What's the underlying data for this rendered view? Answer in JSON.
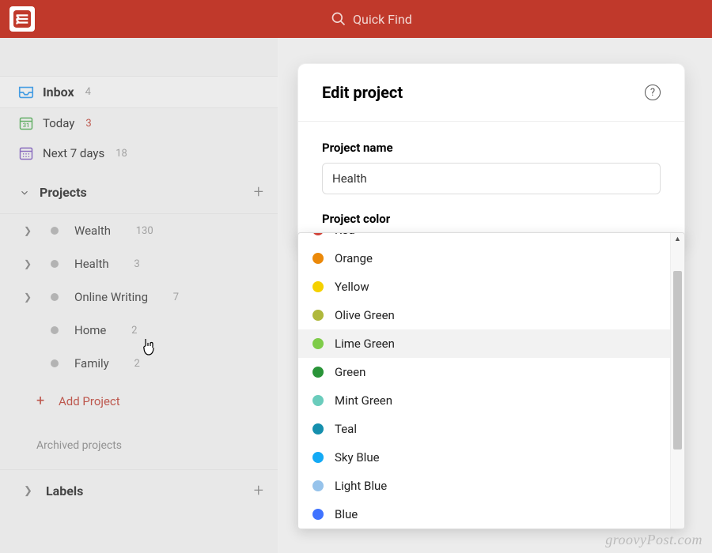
{
  "header": {
    "search_placeholder": "Quick Find"
  },
  "sidebar": {
    "inbox": {
      "label": "Inbox",
      "count": "4"
    },
    "today": {
      "label": "Today",
      "count": "3"
    },
    "next7": {
      "label": "Next 7 days",
      "count": "18"
    },
    "projects_title": "Projects",
    "projects": [
      {
        "name": "Wealth",
        "count": "130",
        "expandable": true
      },
      {
        "name": "Health",
        "count": "3",
        "expandable": true
      },
      {
        "name": "Online Writing",
        "count": "7",
        "expandable": true
      },
      {
        "name": "Home",
        "count": "2",
        "expandable": false
      },
      {
        "name": "Family",
        "count": "2",
        "expandable": false
      }
    ],
    "add_project": "Add Project",
    "archived": "Archived projects",
    "labels_title": "Labels"
  },
  "modal": {
    "title": "Edit project",
    "name_label": "Project name",
    "name_value": "Health",
    "color_label": "Project color"
  },
  "colors": [
    {
      "name": "Red",
      "hex": "#d1453b",
      "partial_top": true
    },
    {
      "name": "Orange",
      "hex": "#eb8909"
    },
    {
      "name": "Yellow",
      "hex": "#f5d100"
    },
    {
      "name": "Olive Green",
      "hex": "#afb83b"
    },
    {
      "name": "Lime Green",
      "hex": "#7ecc49",
      "hovered": true
    },
    {
      "name": "Green",
      "hex": "#299438"
    },
    {
      "name": "Mint Green",
      "hex": "#6accbc"
    },
    {
      "name": "Teal",
      "hex": "#158fad"
    },
    {
      "name": "Sky Blue",
      "hex": "#14aaf5"
    },
    {
      "name": "Light Blue",
      "hex": "#96c3eb"
    },
    {
      "name": "Blue",
      "hex": "#4073ff",
      "partial_bottom": true
    }
  ],
  "watermark": "groovyPost.com"
}
